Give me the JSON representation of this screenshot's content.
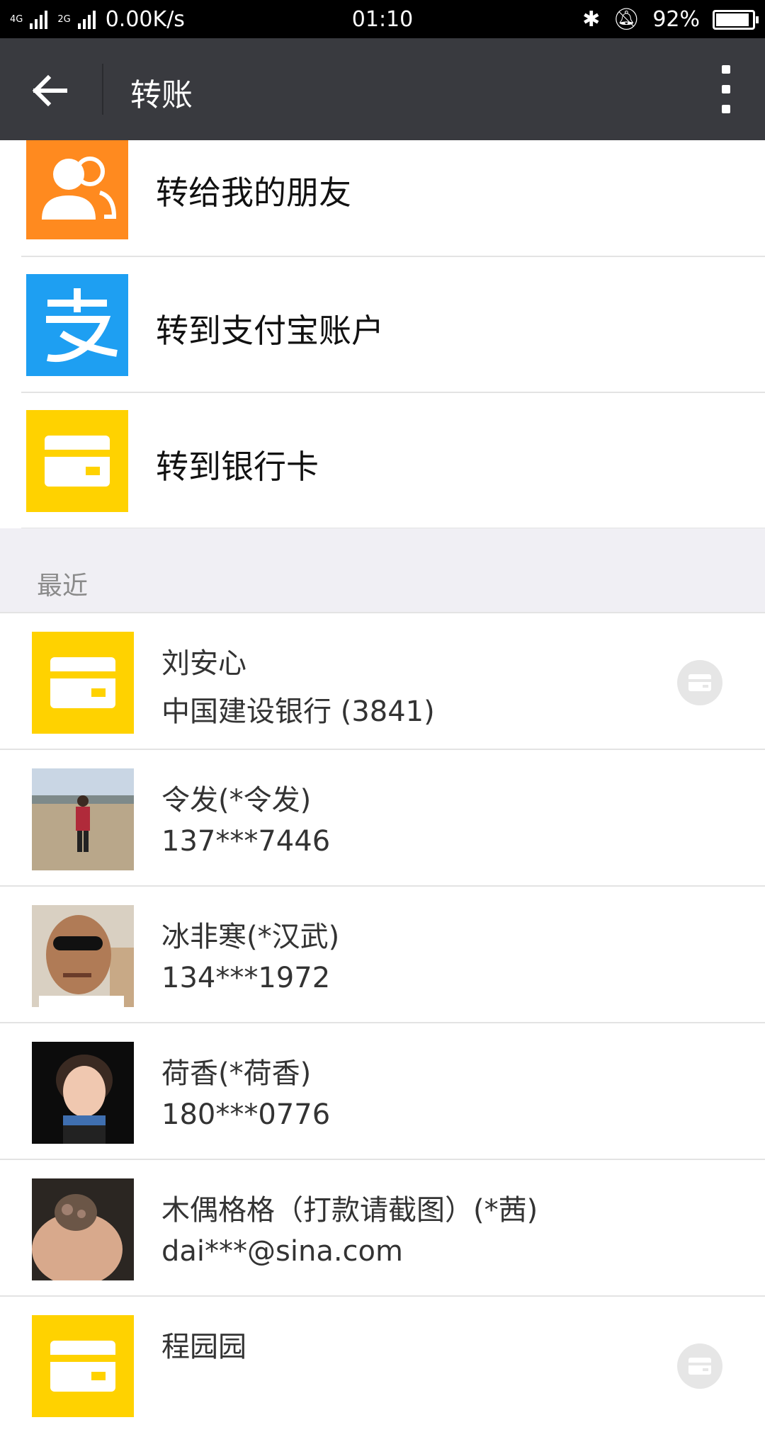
{
  "status_bar": {
    "network_labels": [
      "4G",
      "4G",
      "2G"
    ],
    "speed": "0.00K/s",
    "time": "01:10",
    "battery": "92%",
    "icons": [
      "bluetooth-icon",
      "bell-muted-icon",
      "battery-icon"
    ]
  },
  "header": {
    "title": "转账",
    "back_icon": "back-arrow-icon",
    "menu_icon": "more-vert-icon"
  },
  "options": [
    {
      "label": "转给我的朋友",
      "icon": "friends-icon",
      "color": "#ff8a1f"
    },
    {
      "label": "转到支付宝账户",
      "icon": "alipay-icon",
      "color": "#1e9ff2"
    },
    {
      "label": "转到银行卡",
      "icon": "bank-card-icon",
      "color": "#ffd200"
    }
  ],
  "recent": {
    "header": "最近",
    "items": [
      {
        "name": "刘安心",
        "detail": "中国建设银行 (3841)",
        "avatar": "bank-card-icon",
        "badge": "card-badge-icon"
      },
      {
        "name": "令发(*令发)",
        "detail": "137***7446",
        "avatar": "photo-avatar"
      },
      {
        "name": "冰非寒(*汉武)",
        "detail": "134***1972",
        "avatar": "photo-avatar"
      },
      {
        "name": "荷香(*荷香)",
        "detail": "180***0776",
        "avatar": "photo-avatar"
      },
      {
        "name": "木偶格格（打款请截图）(*茜)",
        "detail": "dai***@sina.com",
        "avatar": "photo-avatar"
      },
      {
        "name": "程园园",
        "detail": "",
        "avatar": "bank-card-icon",
        "badge": "card-badge-icon"
      }
    ]
  }
}
